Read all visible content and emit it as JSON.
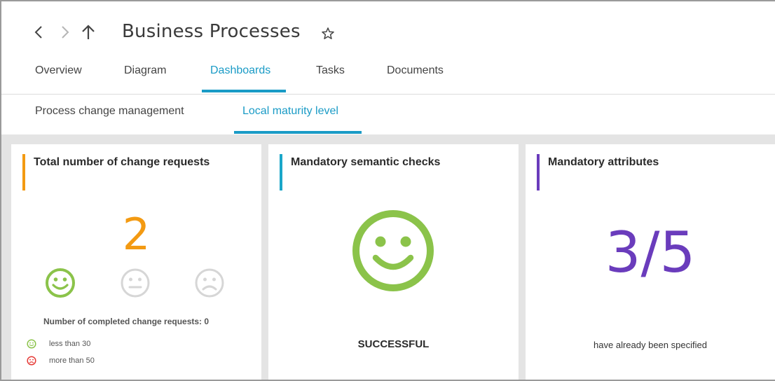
{
  "header": {
    "title": "Business Processes",
    "nav": {
      "back_icon": "chevron-left-icon",
      "forward_icon": "chevron-right-icon",
      "up_icon": "arrow-up-icon"
    },
    "favorite_icon": "star-outline-icon"
  },
  "tabs": [
    {
      "label": "Overview"
    },
    {
      "label": "Diagram"
    },
    {
      "label": "Dashboards",
      "active": true
    },
    {
      "label": "Tasks"
    },
    {
      "label": "Documents"
    }
  ],
  "subtabs": [
    {
      "label": "Process change management"
    },
    {
      "label": "Local maturity level",
      "active": true
    }
  ],
  "cards": {
    "change_requests": {
      "title": "Total number of change requests",
      "value": "2",
      "accent": "#f39a12",
      "faces": [
        "smiley-happy-icon",
        "smiley-neutral-icon",
        "smiley-sad-icon"
      ],
      "completed_caption": "Number of completed change requests: 0",
      "legend": [
        {
          "icon": "smiley-happy-icon",
          "label": "less than 30",
          "color": "#8bc34a"
        },
        {
          "icon": "smiley-sad-icon",
          "label": "more than 50",
          "color": "#e53935"
        }
      ]
    },
    "semantic_checks": {
      "title": "Mandatory semantic checks",
      "accent": "#1aa6c9",
      "status": "SUCCESSFUL",
      "icon": "smiley-happy-icon"
    },
    "attributes": {
      "title": "Mandatory attributes",
      "accent": "#6a3cbc",
      "value": "3/5",
      "caption": "have already been specified"
    }
  },
  "colors": {
    "accent_blue": "#1a9bc6",
    "happy_green": "#8bc34a",
    "neutral_gray": "#d6d6d6",
    "sad_red": "#e53935"
  }
}
